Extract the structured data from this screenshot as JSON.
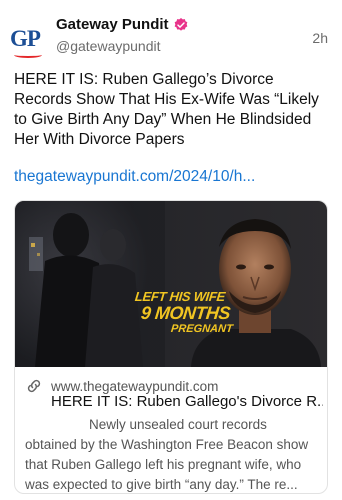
{
  "post": {
    "author": {
      "display_name": "Gateway Pundit",
      "handle": "@gatewaypundit",
      "avatar_text": "GP",
      "verified": true
    },
    "timestamp": "2h",
    "text": "HERE IT IS: Ruben Gallego’s Divorce Records Show That His Ex-Wife Was “Likely to Give Birth Any Day” When He Blindsided Her With Divorce Papers",
    "link_text": "thegatewaypundit.com/2024/10/h..."
  },
  "card": {
    "image_overlay": {
      "line1": "LEFT HIS WIFE",
      "line2": "9 MONTHS",
      "line3": "PREGNANT"
    },
    "domain": "www.thegatewaypundit.com",
    "title": "HERE IT IS: Ruben Gallego's Divorce R...",
    "description": "Newly unsealed court records obtained by the Washington Free Beacon show that Ruben Gallego left his pregnant wife, who was expected to give birth “any day.” The re..."
  },
  "colors": {
    "link": "#1976d2",
    "verified_badge": "#e8338a",
    "overlay_text": "#f1c522",
    "avatar_blue": "#1c4e95",
    "avatar_red": "#e4282a"
  },
  "icons": {
    "verified": "verified-badge-icon",
    "link": "link-icon"
  }
}
